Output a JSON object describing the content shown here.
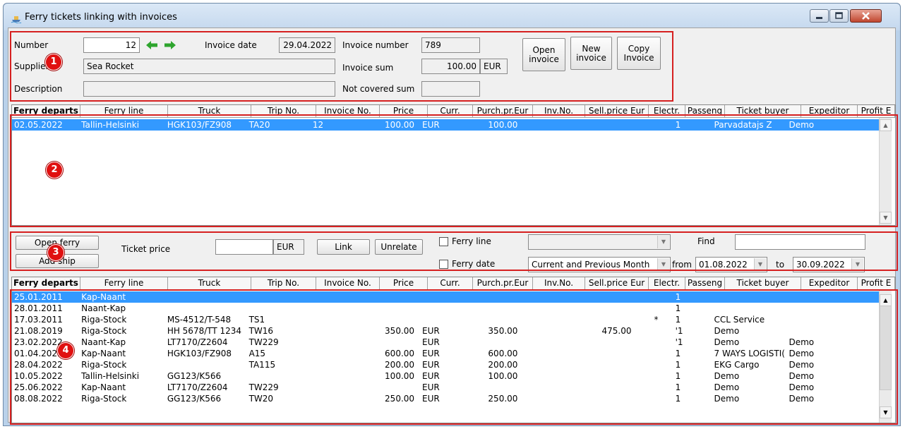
{
  "window": {
    "title": "Ferry tickets linking with invoices"
  },
  "invoice": {
    "number_label": "Number",
    "number_value": "12",
    "invoice_date_label": "Invoice date",
    "invoice_date_value": "29.04.2022",
    "invoice_number_label": "Invoice number",
    "invoice_number_value": "789",
    "supplier_label": "Supplier",
    "supplier_value": "Sea Rocket",
    "invoice_sum_label": "Invoice sum",
    "invoice_sum_value": "100.00",
    "invoice_sum_currency": "EUR",
    "description_label": "Description",
    "description_value": "",
    "not_covered_label": "Not covered sum",
    "not_covered_value": "",
    "open_invoice": [
      "Open",
      "invoice"
    ],
    "new_invoice": [
      "New",
      "invoice"
    ],
    "copy_invoice": [
      "Copy",
      "Invoice"
    ]
  },
  "badges": [
    "1",
    "2",
    "3",
    "4"
  ],
  "columns": [
    "Ferry departs",
    "Ferry line",
    "Truck",
    "Trip No.",
    "Invoice No.",
    "Price",
    "Curr.",
    "Purch.pr.Eur",
    "Inv.No.",
    "Sell.price Eur",
    "Electr.",
    "Passeng",
    "Ticket buyer",
    "Expeditor",
    "Profit E"
  ],
  "linked_rows": [
    [
      "02.05.2022",
      "Tallin-Helsinki",
      "HGK103/FZ908",
      "TA20",
      "12",
      "100.00",
      "EUR",
      "100.00",
      "",
      "",
      "",
      "1",
      "Parvadatajs Z",
      "Demo",
      ""
    ]
  ],
  "controls": {
    "open_ferry": "Open ferry",
    "add_ship": "Add ship",
    "ticket_price_label": "Ticket price",
    "ticket_price_value": "",
    "ticket_price_currency": "EUR",
    "link": "Link",
    "unrelate": "Unrelate",
    "ferry_line_label": "Ferry line",
    "ferry_line_checked": false,
    "ferry_line_value": "",
    "ferry_date_label": "Ferry date",
    "ferry_date_checked": false,
    "find_label": "Find",
    "find_value": "",
    "period_value": "Current and Previous Month",
    "from_label": "from",
    "from_value": "01.08.2022",
    "to_label": "to",
    "to_value": "30.09.2022"
  },
  "available_rows": [
    [
      "25.01.2011",
      "Kap-Naant",
      "",
      "",
      "",
      "",
      "",
      "",
      "",
      "",
      "",
      "1",
      "",
      "",
      ""
    ],
    [
      "28.01.2011",
      "Naant-Kap",
      "",
      "",
      "",
      "",
      "",
      "",
      "",
      "",
      "",
      "1",
      "",
      "",
      ""
    ],
    [
      "17.03.2011",
      "Riga-Stock",
      "MS-4512/T-548",
      "TS1",
      "",
      "",
      "",
      "",
      "",
      "",
      "*",
      "1",
      "CCL Service",
      "",
      ""
    ],
    [
      "21.08.2019",
      "Riga-Stock",
      "HH 5678/TT 1234",
      "TW16",
      "",
      "350.00",
      "EUR",
      "350.00",
      "",
      "475.00",
      "",
      "'1",
      "Demo",
      "",
      ""
    ],
    [
      "23.02.2022",
      "Naant-Kap",
      "LT7170/Z2604",
      "TW229",
      "",
      "",
      "EUR",
      "",
      "",
      "",
      "",
      "'1",
      "Demo",
      "Demo",
      ""
    ],
    [
      "01.04.2022",
      "Kap-Naant",
      "HGK103/FZ908",
      "A15",
      "",
      "600.00",
      "EUR",
      "600.00",
      "",
      "",
      "",
      "1",
      "7 WAYS LOGISTI(",
      "Demo",
      ""
    ],
    [
      "28.04.2022",
      "Riga-Stock",
      "",
      "TA115",
      "",
      "200.00",
      "EUR",
      "200.00",
      "",
      "",
      "",
      "1",
      "EKG Cargo",
      "Demo",
      ""
    ],
    [
      "10.05.2022",
      "Tallin-Helsinki",
      "GG123/K566",
      "",
      "",
      "100.00",
      "EUR",
      "100.00",
      "",
      "",
      "",
      "1",
      "Demo",
      "Demo",
      ""
    ],
    [
      "25.06.2022",
      "Kap-Naant",
      "LT7170/Z2604",
      "TW229",
      "",
      "",
      "EUR",
      "",
      "",
      "",
      "",
      "1",
      "Demo",
      "Demo",
      ""
    ],
    [
      "08.08.2022",
      "Riga-Stock",
      "GG123/K566",
      "TW20",
      "",
      "250.00",
      "EUR",
      "250.00",
      "",
      "",
      "",
      "1",
      "Demo",
      "Demo",
      ""
    ]
  ]
}
